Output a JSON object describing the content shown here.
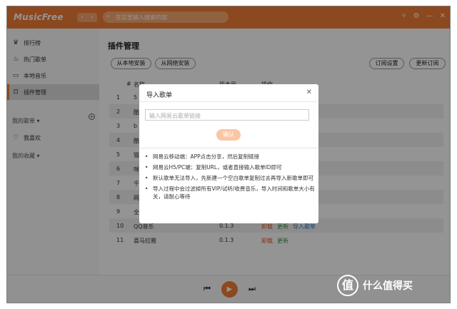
{
  "app": {
    "logo": "MusicFree",
    "back_icon": "chevron-left-icon",
    "forward_icon": "chevron-right-icon",
    "search_placeholder": "在这里输入搜索内容",
    "accent": "#f17d34"
  },
  "sidebar": {
    "items": [
      {
        "label": "排行榜",
        "icon": "trophy-icon"
      },
      {
        "label": "热门歌单",
        "icon": "fire-icon"
      },
      {
        "label": "本地音乐",
        "icon": "folder-icon"
      },
      {
        "label": "插件管理",
        "icon": "plugin-icon"
      }
    ],
    "my_playlists": "我的歌单",
    "my_playlists_arrow": "▾",
    "favorites": "我喜欢",
    "my_collections": "我的收藏",
    "my_collections_arrow": "▾"
  },
  "main": {
    "title": "插件管理",
    "install_local": "从本地安装",
    "install_network": "从网络安装",
    "subscribe_settings": "订阅设置",
    "update_subscription": "更新订阅",
    "columns": {
      "num": "#",
      "name": "名称",
      "version": "版本号",
      "action": "操作"
    },
    "rows": [
      {
        "num": "1",
        "name": "5",
        "version": "",
        "actions": []
      },
      {
        "num": "2",
        "name": "酷",
        "version": "",
        "actions": []
      },
      {
        "num": "3",
        "name": "b",
        "version": "",
        "actions": []
      },
      {
        "num": "4",
        "name": "酷",
        "version": "",
        "actions": []
      },
      {
        "num": "5",
        "name": "猫",
        "version": "",
        "actions": []
      },
      {
        "num": "6",
        "name": "咪",
        "version": "",
        "actions": []
      },
      {
        "num": "7",
        "name": "千",
        "version": "",
        "actions": []
      },
      {
        "num": "8",
        "name": "网",
        "version": "",
        "actions": []
      },
      {
        "num": "9",
        "name": "全",
        "version": "",
        "actions": []
      },
      {
        "num": "10",
        "name": "QQ音乐",
        "version": "0.1.3",
        "actions": [
          "卸载",
          "更新",
          "导入歌单"
        ]
      },
      {
        "num": "11",
        "name": "喜马拉雅",
        "version": "0.1.3",
        "actions": [
          "卸载",
          "更新"
        ]
      }
    ]
  },
  "player": {
    "prev_icon": "skip-back-icon",
    "play_icon": "play-icon",
    "next_icon": "skip-forward-icon"
  },
  "dialog": {
    "title": "导入歌单",
    "close": "✕",
    "input_placeholder": "输入网易云歌单链接",
    "confirm": "确认",
    "tips": [
      "网易云移动端：APP点击分享，然后复制链接",
      "网易云H5/PC端：复制URL，或者直接输入歌单ID即可",
      "默认歌单无法导入，先新建一个空白歌单复制过去再导入新歌单即可",
      "导入过程中会过滤掉所有VIP/试听/收费音乐，导入时间和歌单大小有关，请耐心等待"
    ]
  },
  "watermark": {
    "glyph": "值",
    "text": "什么值得买"
  }
}
